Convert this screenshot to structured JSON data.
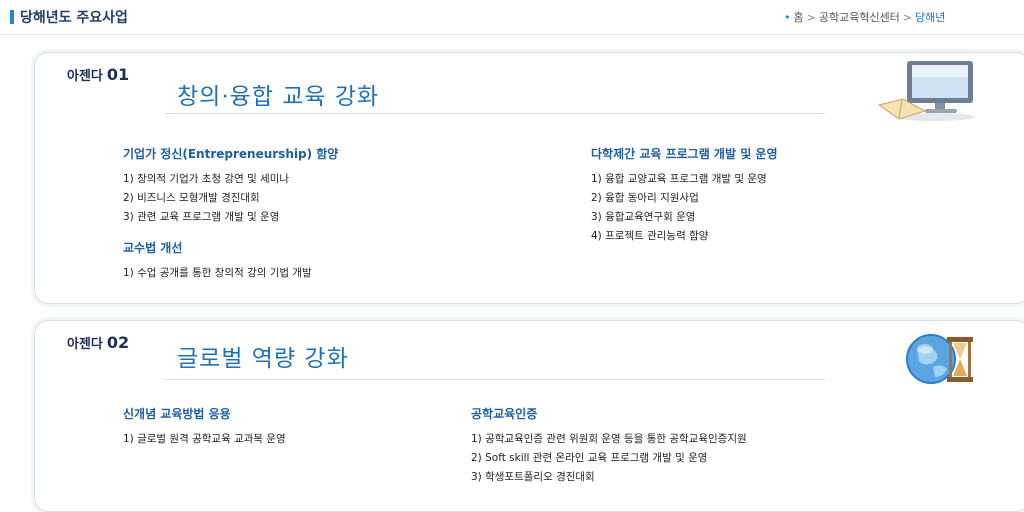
{
  "header": {
    "title": "당해년도 주요사업",
    "breadcrumb": [
      "홈",
      "공학교육혁신센터",
      "당해년"
    ]
  },
  "agendas": [
    {
      "label": "아젠다",
      "number": "01",
      "title": "창의·융합 교육 강화",
      "icon": "computer-icon",
      "sections": [
        {
          "heading": "기업가 정신(Entrepreneurship) 함양",
          "items": [
            "1) 창의적 기업가 초청 강연 및 세미나",
            "2) 비즈니스 모형개발 경진대회",
            "3) 관련 교육 프로그램 개발 및 운영"
          ]
        },
        {
          "heading": "교수법 개선",
          "items": [
            "1) 수업 공개를 통한 창의적 강의 기법 개발"
          ]
        },
        {
          "heading": "다학제간 교육 프로그램 개발 및 운영",
          "items": [
            "1) 융합 교양교육 프로그램 개발 및 운영",
            "2) 융합 동아리 지원사업",
            "3) 융합교육연구회 운영",
            "4) 프로젝트 관리능력 함양"
          ]
        }
      ]
    },
    {
      "label": "아젠다",
      "number": "02",
      "title": "글로벌 역량 강화",
      "icon": "globe-hourglass-icon",
      "sections": [
        {
          "heading": "신개념 교육방법 응용",
          "items": [
            "1) 글로벌 원격 공학교육 교과목 운영"
          ]
        },
        {
          "heading": "공학교육인증",
          "items": [
            "1) 공학교육인증 관련 위원회 운영 등을 통한 공학교육인증지원",
            "2) Soft skill 관련 온라인 교육 프로그램 개발 및 운영",
            "3) 학생포트폴리오 경진대회"
          ]
        }
      ]
    }
  ]
}
